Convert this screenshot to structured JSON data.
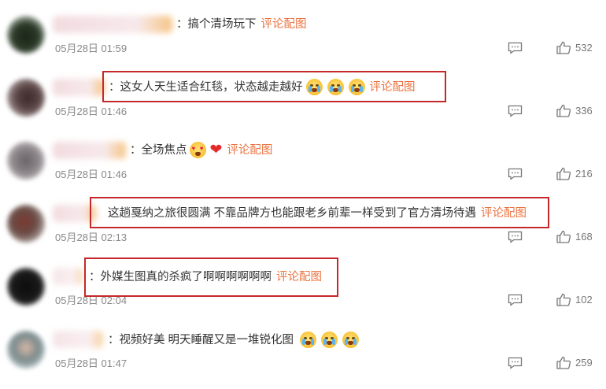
{
  "comments": [
    {
      "text": "：搞个清场玩下",
      "tag": "评论配图",
      "emojis": [],
      "time": "05月28日 01:59",
      "likes": "532",
      "highlighted": false
    },
    {
      "text": "：这女人天生适合红毯，状态越走越好",
      "tag": "评论配图",
      "emojis": [
        "crying-face",
        "crying-face",
        "crying-face"
      ],
      "time": "05月28日 01:46",
      "likes": "336",
      "highlighted": true
    },
    {
      "text": "：全场焦点",
      "tag": "评论配图",
      "emojis": [
        "heart-eyes",
        "red-heart"
      ],
      "time": "05月28日 01:46",
      "likes": "216",
      "highlighted": false
    },
    {
      "text": "这趟戛纳之旅很圆满 不靠品牌方也能跟老乡前辈一样受到了官方清场待遇",
      "tag": "评论配图",
      "emojis": [],
      "time": "05月28日 02:13",
      "likes": "168",
      "highlighted": true
    },
    {
      "text": "：外媒生图真的杀疯了啊啊啊啊啊啊",
      "tag": "评论配图",
      "emojis": [],
      "time": "05月28日 02:04",
      "likes": "102",
      "highlighted": true
    },
    {
      "text": "：视频好美 明天睡醒又是一堆锐化图",
      "tag": "",
      "emojis": [
        "crying-face",
        "crying-face",
        "crying-face"
      ],
      "time": "05月28日 01:47",
      "likes": "259",
      "highlighted": false
    }
  ],
  "colors": {
    "highlight_border": "#c4282a",
    "tag": "#eb7340",
    "time": "#888888"
  },
  "icons": {
    "reply": "comment-icon",
    "like": "thumbs-up-icon"
  }
}
